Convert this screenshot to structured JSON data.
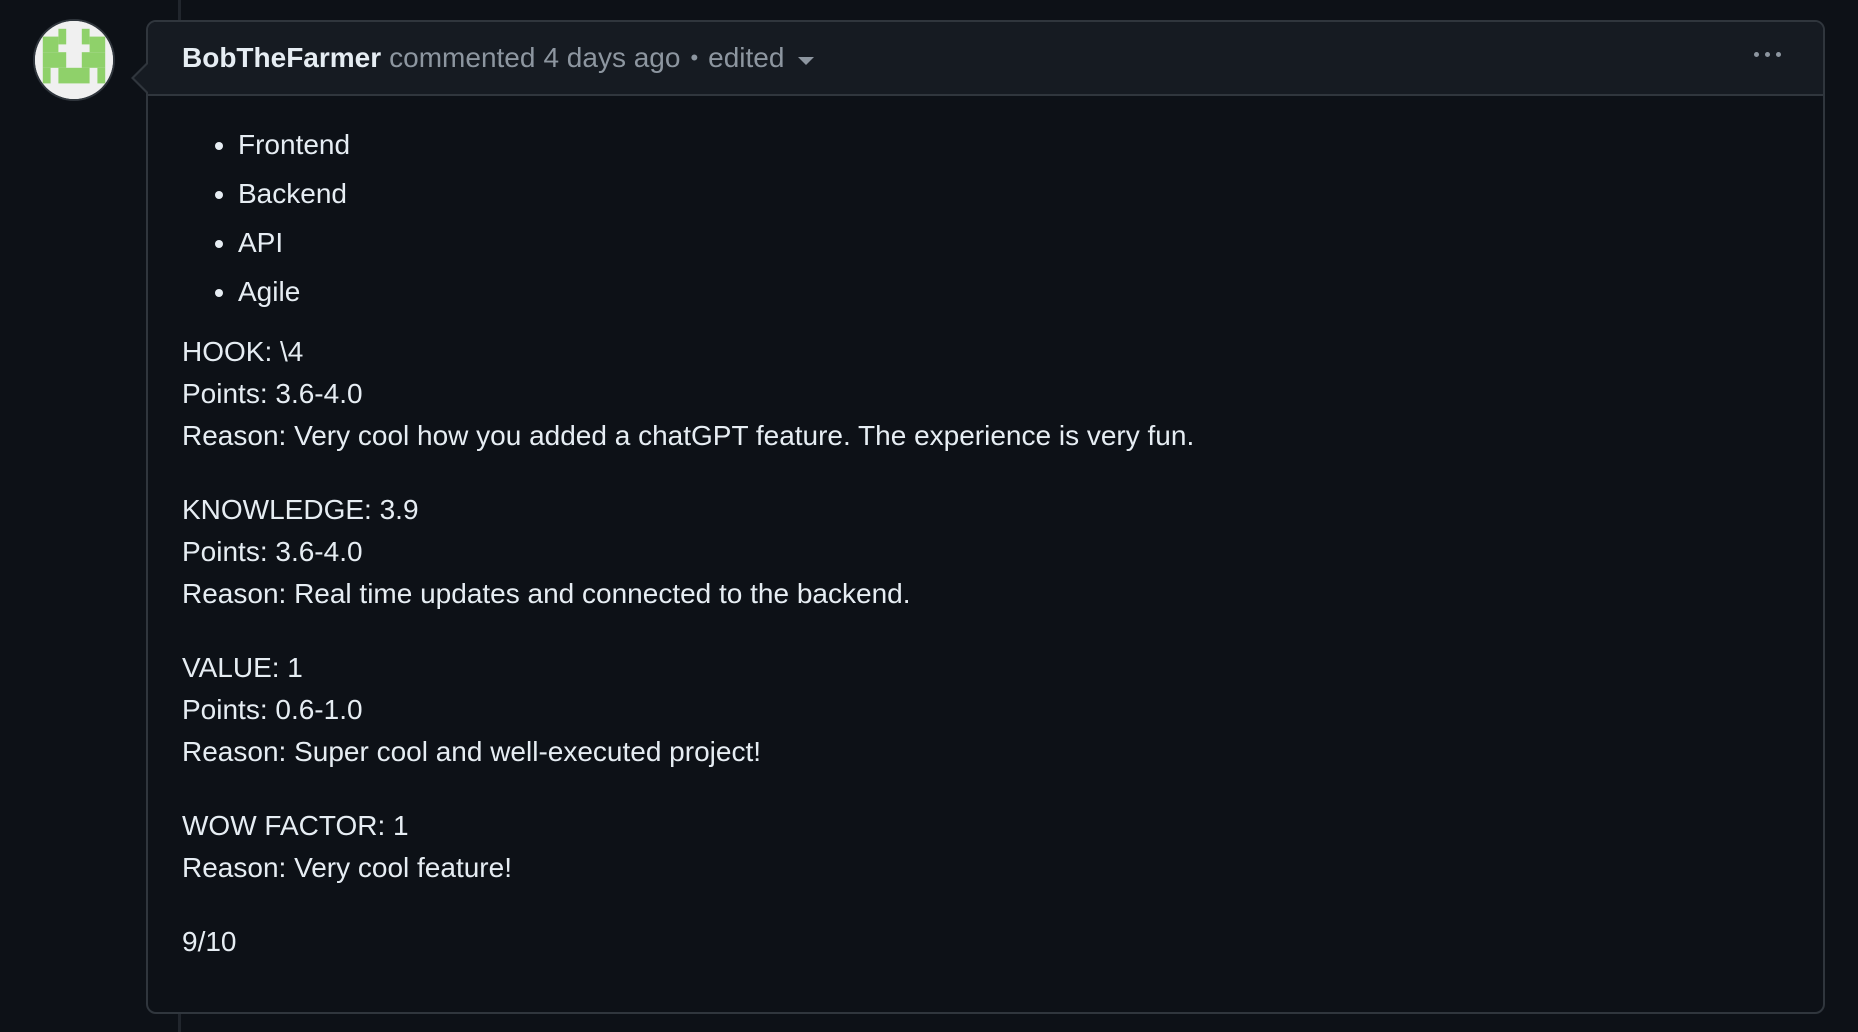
{
  "comment": {
    "author": "BobTheFarmer",
    "action": "commented",
    "time": "4 days ago",
    "separator": "•",
    "edited_label": "edited",
    "avatar_colors": {
      "background": "#f0f0f0",
      "accent": "#8fd16a"
    }
  },
  "body": {
    "list_items": [
      "Frontend",
      "Backend",
      "API",
      "Agile"
    ],
    "sections": [
      {
        "lines": [
          "HOOK: \\4",
          "Points: 3.6-4.0",
          "Reason: Very cool how you added a chatGPT feature. The experience is very fun."
        ]
      },
      {
        "lines": [
          "KNOWLEDGE: 3.9",
          "Points: 3.6-4.0",
          "Reason: Real time updates and connected to the backend."
        ]
      },
      {
        "lines": [
          "VALUE: 1",
          "Points: 0.6-1.0",
          "Reason: Super cool and well-executed project!"
        ]
      },
      {
        "lines": [
          "WOW FACTOR: 1",
          "Reason: Very cool feature!"
        ]
      },
      {
        "lines": [
          "9/10"
        ]
      }
    ]
  }
}
